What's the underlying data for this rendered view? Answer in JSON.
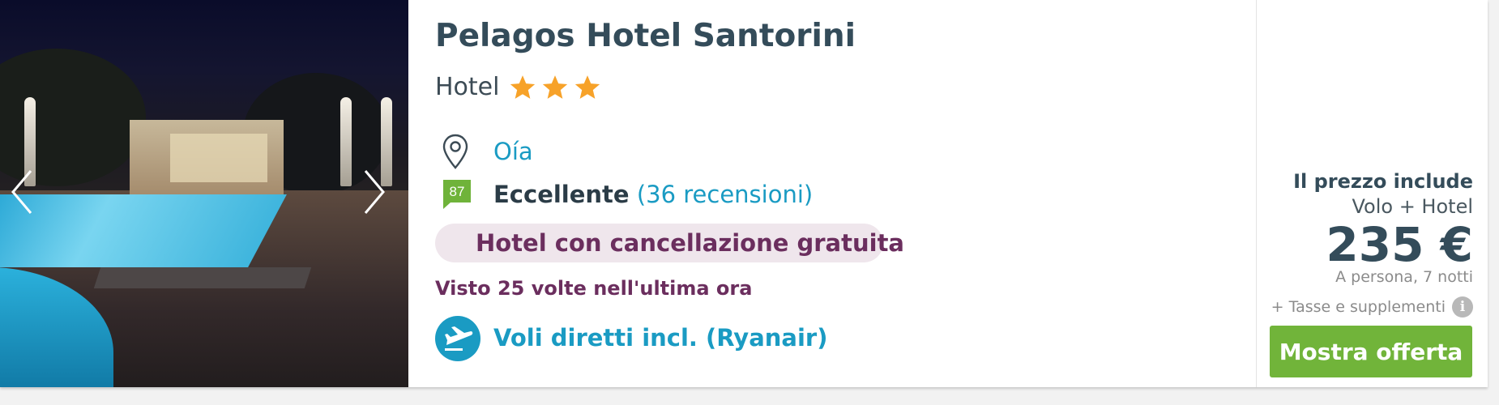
{
  "hotel": {
    "name": "Pelagos Hotel Santorini",
    "type": "Hotel",
    "stars": 3,
    "location": "Oía",
    "score": "87",
    "rating_word": "Eccellente",
    "reviews_text": "(36 recensioni)",
    "free_cancellation": "Hotel con cancellazione gratuita",
    "viewed_text": "Visto 25 volte nell'ultima ora",
    "flights_text": "Voli diretti incl. (Ryanair)"
  },
  "price_box": {
    "includes_label": "Il prezzo include",
    "includes_value": "Volo + Hotel",
    "price": "235 €",
    "per_person": "A persona, 7 notti",
    "taxes": "+ Tasse e supplementi",
    "info_glyph": "i",
    "cta_label": "Mostra offerta"
  },
  "icons": {
    "gallery_prev": "chevron-left-icon",
    "gallery_next": "chevron-right-icon",
    "star": "star-icon",
    "location": "map-pin-icon",
    "score": "score-flag-icon",
    "cancellation": "shield-check-icon",
    "flight": "plane-icon",
    "info": "info-icon"
  },
  "colors": {
    "title": "#344c5a",
    "link": "#1a9bc3",
    "star": "#f7a229",
    "score_badge": "#6fb33a",
    "cancel_pill_bg": "#efe6ec",
    "cancel_text": "#6b2e5e",
    "cta": "#71b43a"
  }
}
